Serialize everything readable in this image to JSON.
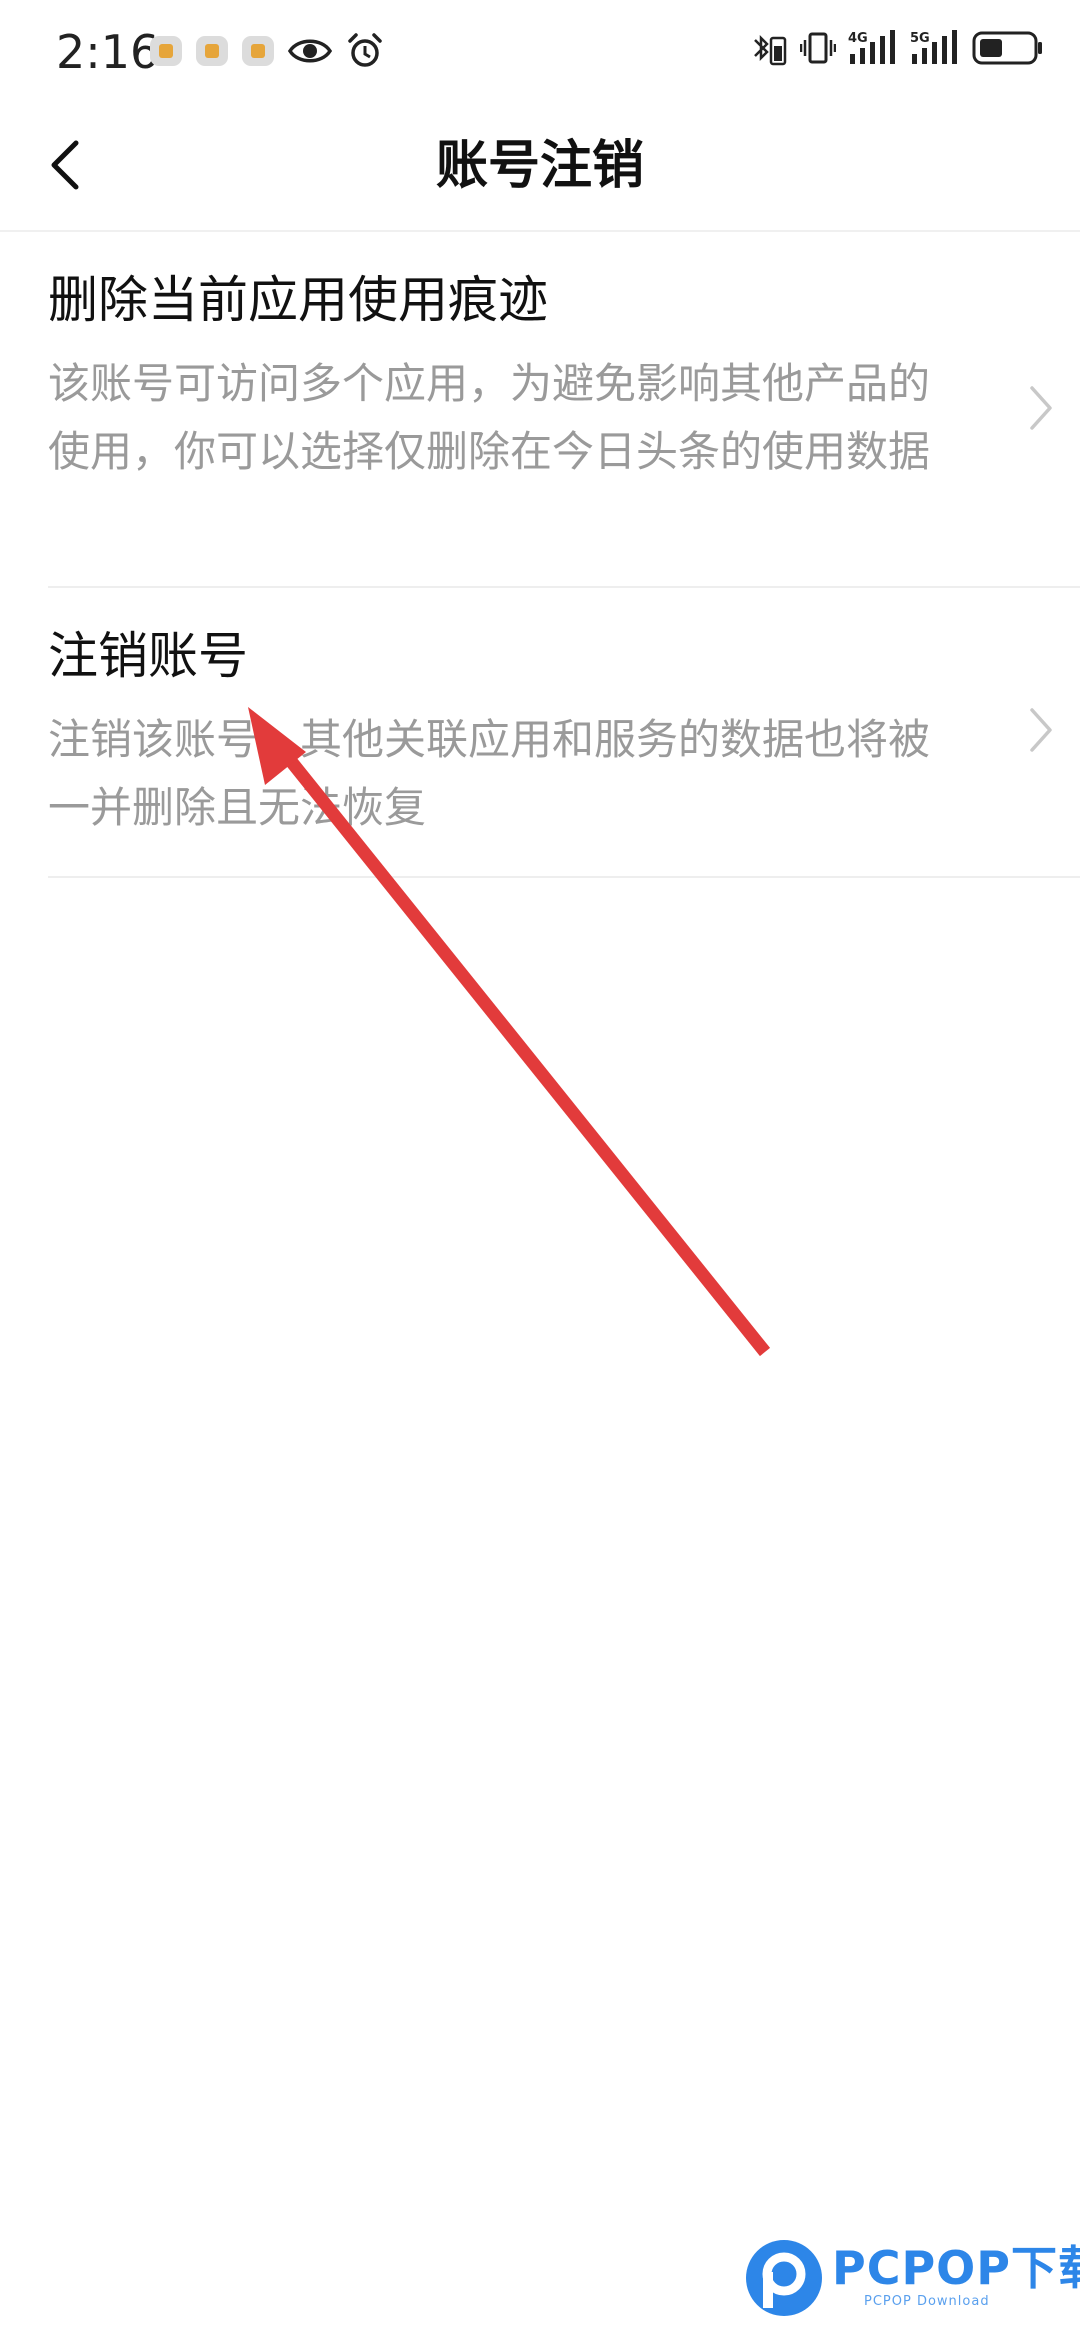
{
  "status_bar": {
    "time": "2:16",
    "notification_icons": [
      "app-notification-icon",
      "app-notification-icon",
      "app-notification-icon",
      "eye-icon",
      "alarm-icon"
    ],
    "system_icons": [
      "bluetooth-battery-icon",
      "vibrate-icon",
      "signal-4g-icon",
      "signal-5g-icon",
      "battery-icon"
    ],
    "signal_1_label": "4G",
    "signal_2_label": "5G"
  },
  "nav": {
    "back_icon": "chevron-left-icon",
    "title": "账号注销"
  },
  "list": {
    "items": [
      {
        "title": "删除当前应用使用痕迹",
        "description": "该账号可访问多个应用，为避免影响其他产品的使用，你可以选择仅删除在今日头条的使用数据",
        "icon": "chevron-right-icon"
      },
      {
        "title": "注销账号",
        "description": "注销该账号，其他关联应用和服务的数据也将被一并删除且无法恢复",
        "icon": "chevron-right-icon"
      }
    ]
  },
  "annotation": {
    "arrow_color": "#e23b3b",
    "icon": "red-arrow-annotation"
  },
  "watermark": {
    "brand": "PCPOP下载",
    "sub": "PCPOP Download",
    "color": "#2d86e8"
  }
}
